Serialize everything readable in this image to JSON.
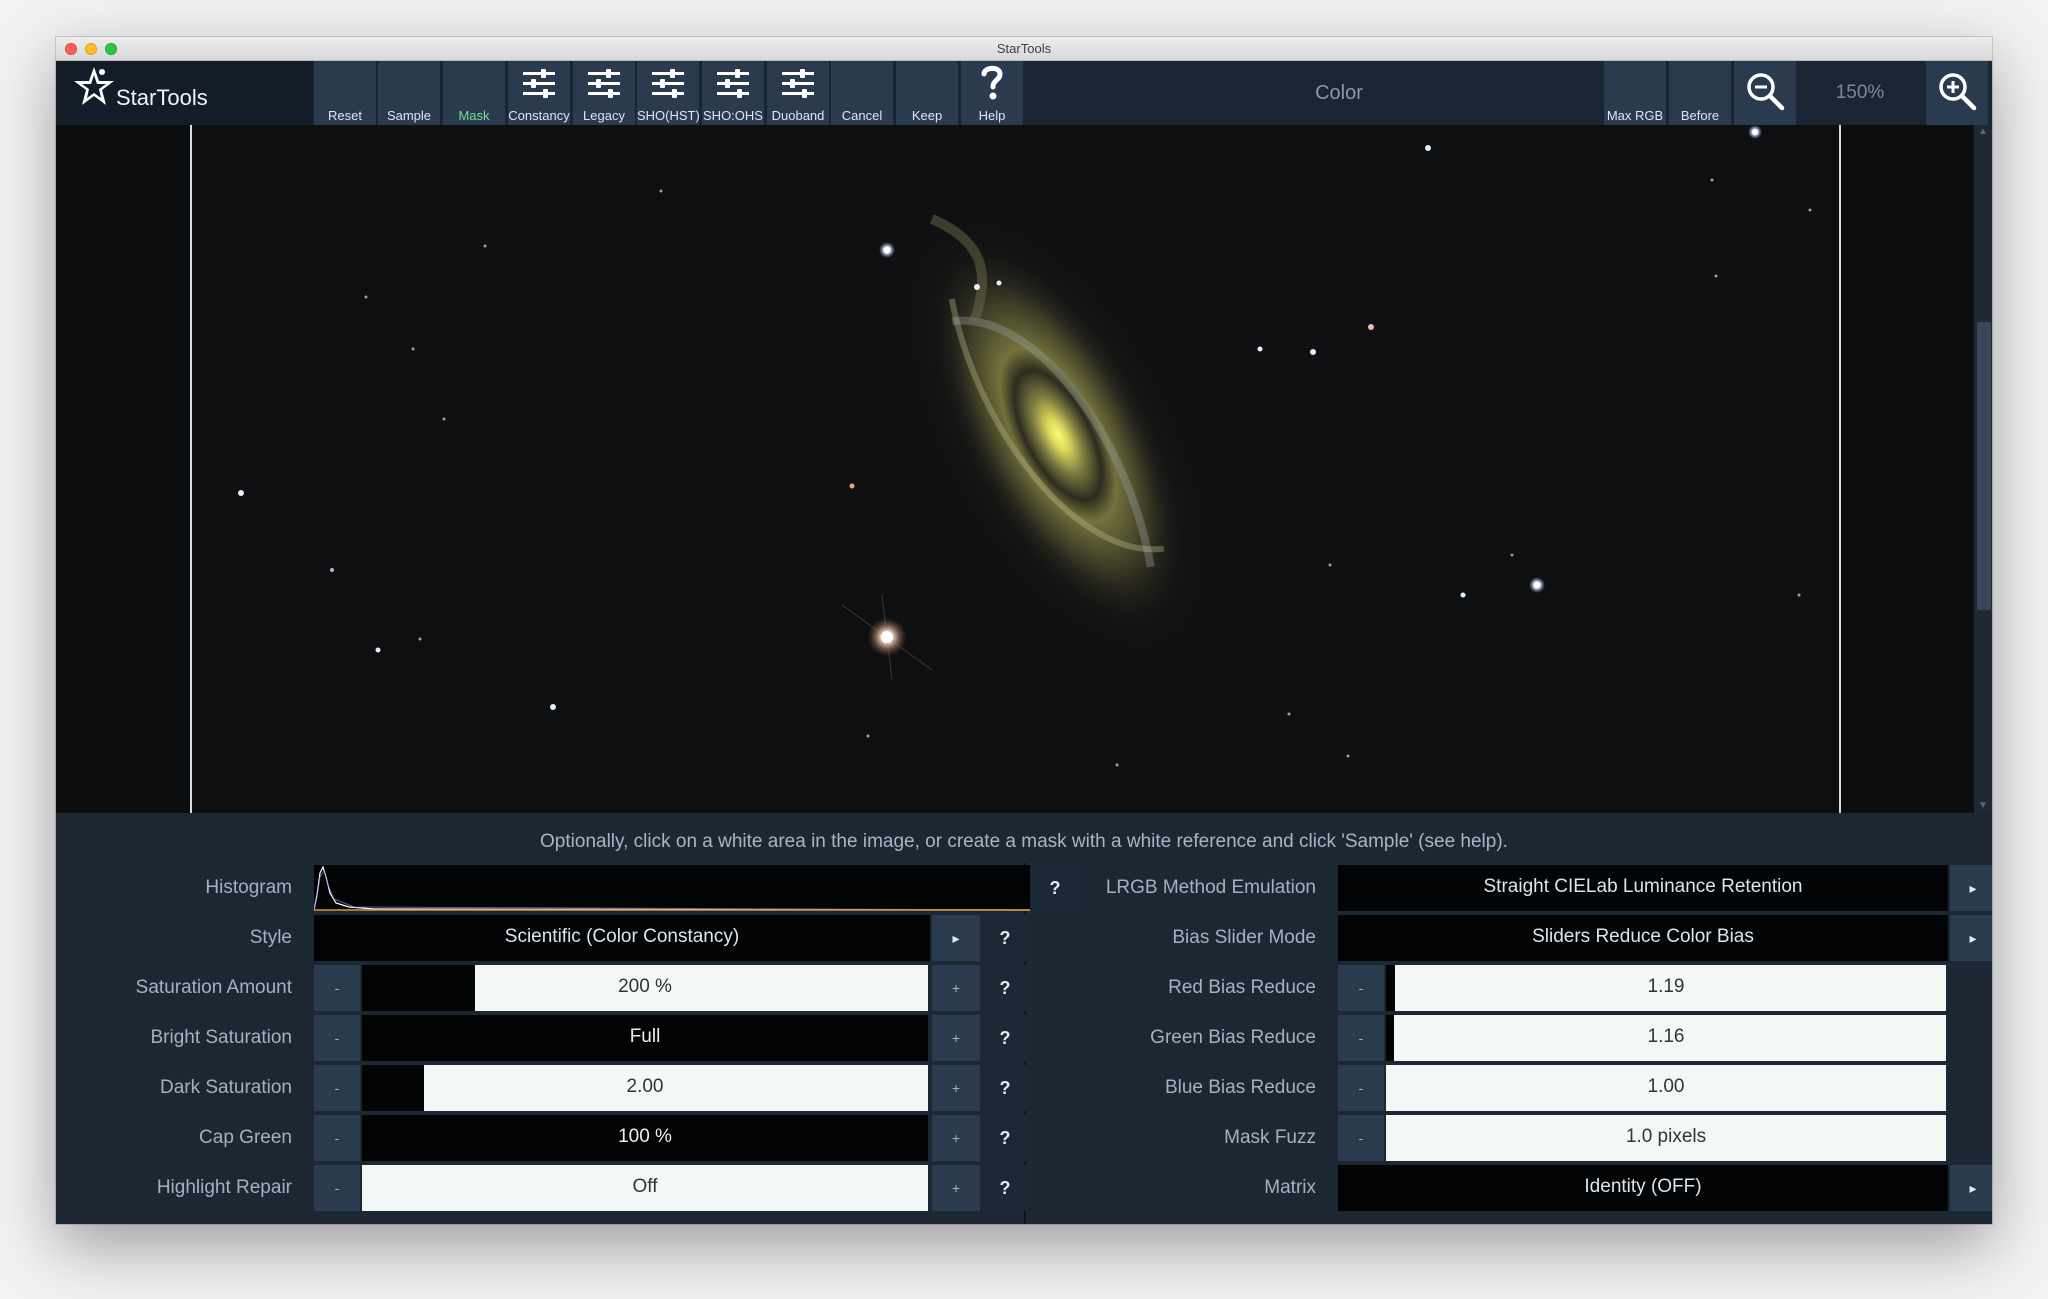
{
  "window": {
    "title": "StarTools"
  },
  "app": {
    "name": "StarTools",
    "module": "Color"
  },
  "toolbar": {
    "buttons": [
      {
        "label": "Reset",
        "icon": "none"
      },
      {
        "label": "Sample",
        "icon": "none"
      },
      {
        "label": "Mask",
        "icon": "none",
        "active": true
      },
      {
        "label": "Constancy",
        "icon": "sliders-icon"
      },
      {
        "label": "Legacy",
        "icon": "sliders-icon"
      },
      {
        "label": "SHO(HST)",
        "icon": "sliders-icon"
      },
      {
        "label": "SHO:OHS",
        "icon": "sliders-icon"
      },
      {
        "label": "Duoband",
        "icon": "sliders-icon"
      },
      {
        "label": "Cancel",
        "icon": "none"
      },
      {
        "label": "Keep",
        "icon": "none"
      },
      {
        "label": "Help",
        "icon": "question-icon"
      }
    ],
    "max_rgb_label": "Max RGB",
    "before_label": "Before",
    "zoom_level": "150%"
  },
  "hint": "Optionally, click on a white area in the image, or create a mask with a white reference and click 'Sample' (see help).",
  "left_params": {
    "histogram_label": "Histogram",
    "style": {
      "label": "Style",
      "value": "Scientific (Color Constancy)"
    },
    "saturation_amount": {
      "label": "Saturation Amount",
      "value": "200 %",
      "fill": 0.2
    },
    "bright_saturation": {
      "label": "Bright Saturation",
      "value": "Full",
      "fill": 1.0
    },
    "dark_saturation": {
      "label": "Dark Saturation",
      "value": "2.00",
      "fill": 0.11
    },
    "cap_green": {
      "label": "Cap Green",
      "value": "100 %",
      "fill": 1.0
    },
    "highlight_repair": {
      "label": "Highlight Repair",
      "value": "Off",
      "fill": 0.0
    }
  },
  "right_params": {
    "lrgb_method": {
      "label": "LRGB Method Emulation",
      "value": "Straight CIELab Luminance Retention"
    },
    "bias_slider_mode": {
      "label": "Bias Slider Mode",
      "value": "Sliders Reduce Color Bias"
    },
    "red_bias": {
      "label": "Red Bias Reduce",
      "value": "1.19",
      "fill": 0.016
    },
    "green_bias": {
      "label": "Green Bias Reduce",
      "value": "1.16",
      "fill": 0.014
    },
    "blue_bias": {
      "label": "Blue Bias Reduce",
      "value": "1.00",
      "fill": 0.0
    },
    "mask_fuzz": {
      "label": "Mask Fuzz",
      "value": "1.0 pixels",
      "fill": 0.0
    },
    "matrix": {
      "label": "Matrix",
      "value": "Identity (OFF)"
    }
  },
  "controls": {
    "minus": "-",
    "plus": "+",
    "help": "?",
    "more": "▸"
  }
}
